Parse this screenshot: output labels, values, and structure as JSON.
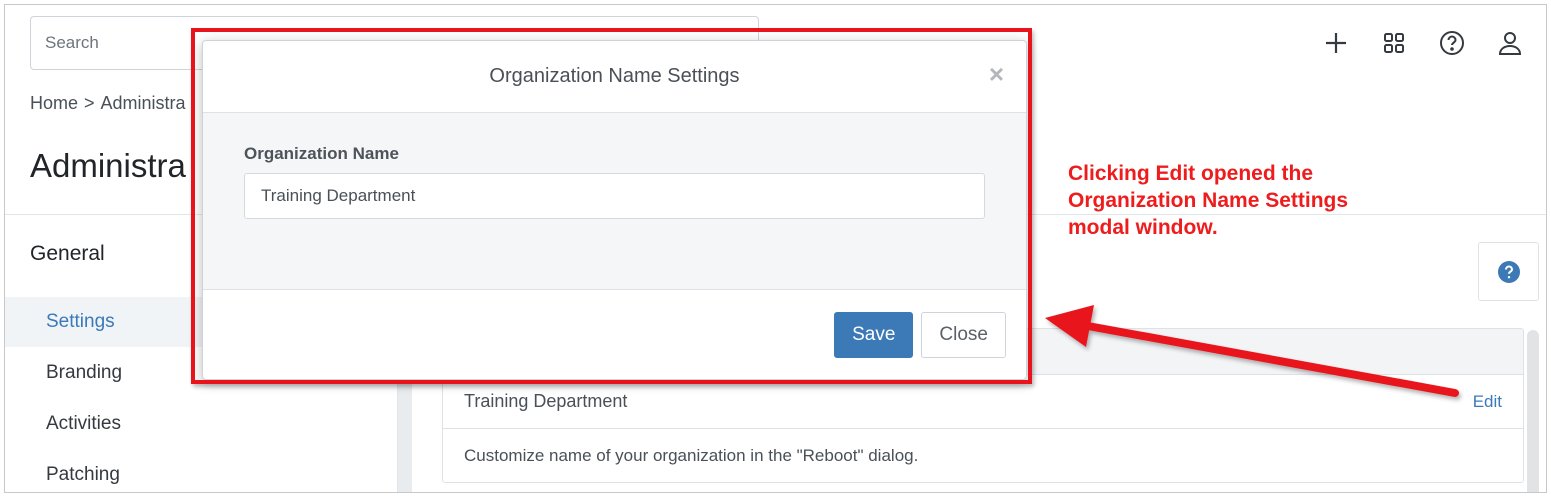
{
  "search": {
    "placeholder": "Search"
  },
  "breadcrumb": {
    "home": "Home",
    "separator": ">",
    "current": "Administra"
  },
  "page": {
    "title": "Administra"
  },
  "sidebar": {
    "heading": "General",
    "items": [
      {
        "label": "Settings",
        "active": true
      },
      {
        "label": "Branding",
        "active": false
      },
      {
        "label": "Activities",
        "active": false
      },
      {
        "label": "Patching",
        "active": false
      }
    ]
  },
  "card": {
    "value": "Training Department",
    "edit_label": "Edit",
    "description": "Customize name of your organization in the \"Reboot\" dialog."
  },
  "modal": {
    "title": "Organization Name Settings",
    "close_glyph": "×",
    "field_label": "Organization Name",
    "field_value": "Training Department",
    "save_label": "Save",
    "close_label": "Close"
  },
  "annotation": {
    "line1": "Clicking Edit opened the",
    "line2": "Organization Name Settings",
    "line3": "modal window."
  },
  "colors": {
    "accent": "#3b7ab6",
    "annotation_red": "#e8141b"
  },
  "icons": [
    "plus-icon",
    "apps-grid-icon",
    "help-circle-icon",
    "user-icon",
    "help-badge-icon",
    "close-icon"
  ]
}
